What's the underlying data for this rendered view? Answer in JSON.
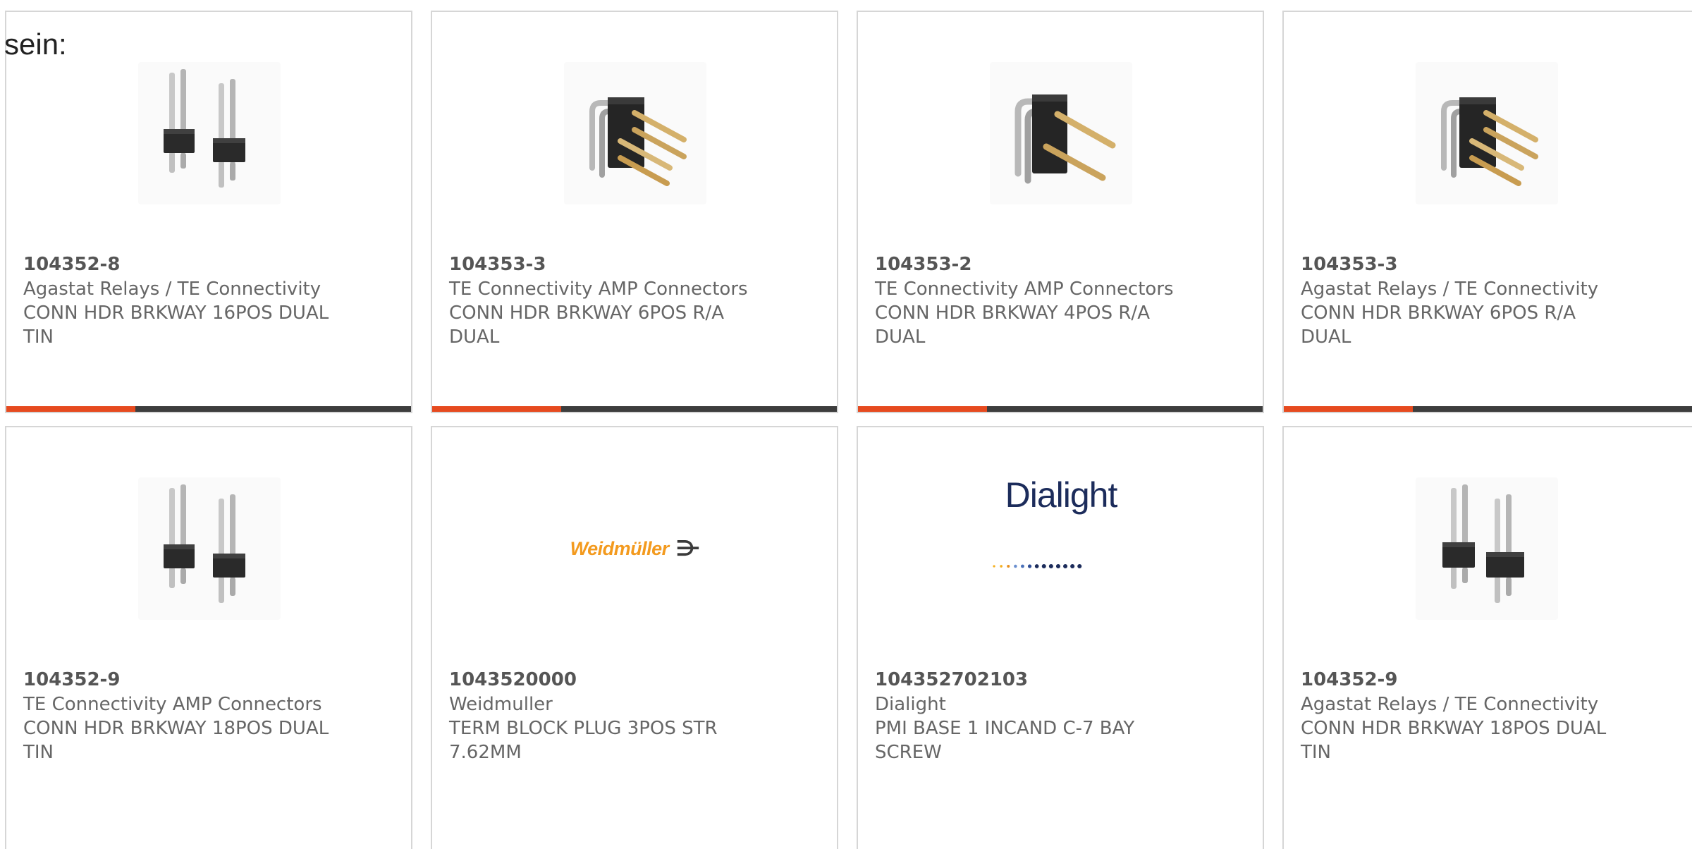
{
  "header_fragment": "sein:",
  "products": [
    {
      "part_number": "104352-8",
      "manufacturer": "Agastat Relays / TE Connectivity",
      "description": "CONN HDR BRKWAY 16POS DUAL TIN",
      "image_icon": "straight-pin-header-icon"
    },
    {
      "part_number": "104353-3",
      "manufacturer": "TE Connectivity AMP Connectors",
      "description": "CONN HDR BRKWAY 6POS R/A DUAL",
      "image_icon": "right-angle-header-icon"
    },
    {
      "part_number": "104353-2",
      "manufacturer": "TE Connectivity AMP Connectors",
      "description": "CONN HDR BRKWAY 4POS R/A DUAL",
      "image_icon": "right-angle-header-icon"
    },
    {
      "part_number": "104353-3",
      "manufacturer": "Agastat Relays / TE Connectivity",
      "description": "CONN HDR BRKWAY 6POS R/A DUAL",
      "image_icon": "right-angle-header-icon"
    },
    {
      "part_number": "104352-9",
      "manufacturer": "TE Connectivity AMP Connectors",
      "description": "CONN HDR BRKWAY 18POS DUAL TIN",
      "image_icon": "straight-pin-header-icon"
    },
    {
      "part_number": "1043520000",
      "manufacturer": "Weidmuller",
      "description": "TERM BLOCK PLUG 3POS STR 7.62MM",
      "image_icon": "weidmuller-logo",
      "logo_text": "Weidmüller"
    },
    {
      "part_number": "104352702103",
      "manufacturer": "Dialight",
      "description": "PMI BASE 1 INCAND C-7 BAY SCREW",
      "image_icon": "dialight-logo",
      "logo_text": "Dialight"
    },
    {
      "part_number": "104352-9",
      "manufacturer": "Agastat Relays / TE Connectivity",
      "description": "CONN HDR BRKWAY 18POS DUAL TIN",
      "image_icon": "straight-pin-header-icon"
    }
  ],
  "colors": {
    "accent": "#e64a1f",
    "bar_dark": "#3d3d3d",
    "card_border": "#d6d6d6",
    "text_gray": "#666666",
    "weidmuller_orange": "#f39a1e",
    "dialight_navy": "#1c2c5b"
  }
}
